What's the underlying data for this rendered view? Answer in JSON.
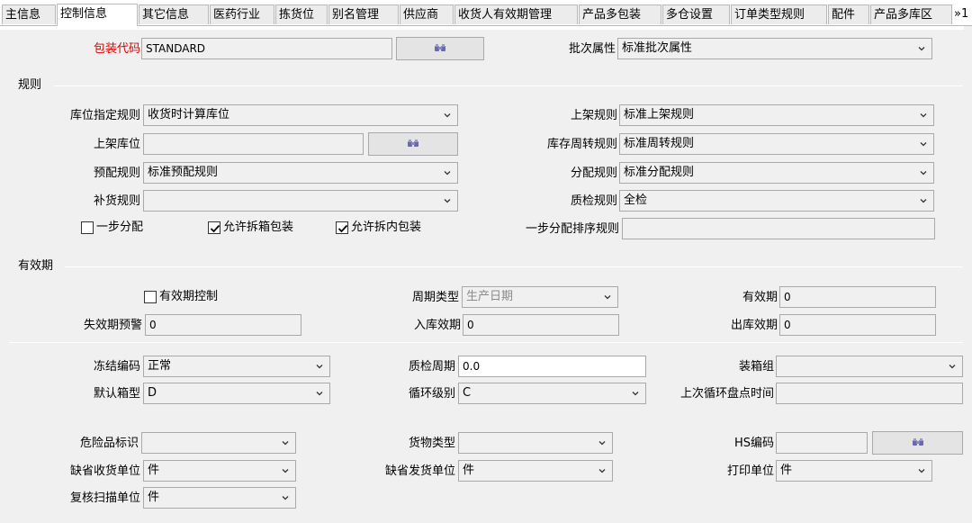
{
  "tabs": [
    "主信息",
    "控制信息",
    "其它信息",
    "医药行业",
    "拣货位",
    "别名管理",
    "供应商",
    "收货人有效期管理",
    "产品多包装",
    "多仓设置",
    "订单类型规则",
    "配件",
    "产品多库区"
  ],
  "tab_more": "»1",
  "package": {
    "label": "包装代码",
    "value": "STANDARD"
  },
  "batch": {
    "label": "批次属性",
    "value": "标准批次属性"
  },
  "rules": {
    "title": "规则",
    "loc_rule": {
      "label": "库位指定规则",
      "value": "收货时计算库位"
    },
    "putaway_rule": {
      "label": "上架规则",
      "value": "标准上架规则"
    },
    "putaway_loc": {
      "label": "上架库位",
      "value": ""
    },
    "rotation_rule": {
      "label": "库存周转规则",
      "value": "标准周转规则"
    },
    "prealloc_rule": {
      "label": "预配规则",
      "value": "标准预配规则"
    },
    "alloc_rule": {
      "label": "分配规则",
      "value": "标准分配规则"
    },
    "replen_rule": {
      "label": "补货规则",
      "value": ""
    },
    "qc_rule": {
      "label": "质检规则",
      "value": "全检"
    },
    "one_step": {
      "label": "一步分配",
      "checked": false
    },
    "allow_split_case": {
      "label": "允许拆箱包装",
      "checked": true
    },
    "allow_split_inner": {
      "label": "允许拆内包装",
      "checked": true
    },
    "one_step_sort": {
      "label": "一步分配排序规则",
      "value": ""
    }
  },
  "expiry": {
    "title": "有效期",
    "control": {
      "label": "有效期控制",
      "checked": false
    },
    "cycle_type": {
      "label": "周期类型",
      "value": "生产日期"
    },
    "validity": {
      "label": "有效期",
      "value": "0"
    },
    "warn": {
      "label": "失效期预警",
      "value": "0"
    },
    "inbound": {
      "label": "入库效期",
      "value": "0"
    },
    "outbound": {
      "label": "出库效期",
      "value": "0"
    }
  },
  "misc": {
    "freeze": {
      "label": "冻结编码",
      "value": "正常"
    },
    "qc_cycle": {
      "label": "质检周期",
      "value": "0.0"
    },
    "case_group": {
      "label": "装箱组",
      "value": ""
    },
    "default_box": {
      "label": "默认箱型",
      "value": "D"
    },
    "cycle_level": {
      "label": "循环级别",
      "value": "C"
    },
    "last_count": {
      "label": "上次循环盘点时间",
      "value": ""
    },
    "hazard": {
      "label": "危险品标识",
      "value": ""
    },
    "goods_type": {
      "label": "货物类型",
      "value": ""
    },
    "hs_code": {
      "label": "HS编码",
      "value": ""
    },
    "recv_unit": {
      "label": "缺省收货单位",
      "value": "件"
    },
    "ship_unit": {
      "label": "缺省发货单位",
      "value": "件"
    },
    "print_unit": {
      "label": "打印单位",
      "value": "件"
    },
    "recheck_unit": {
      "label": "复核扫描单位",
      "value": "件"
    }
  }
}
